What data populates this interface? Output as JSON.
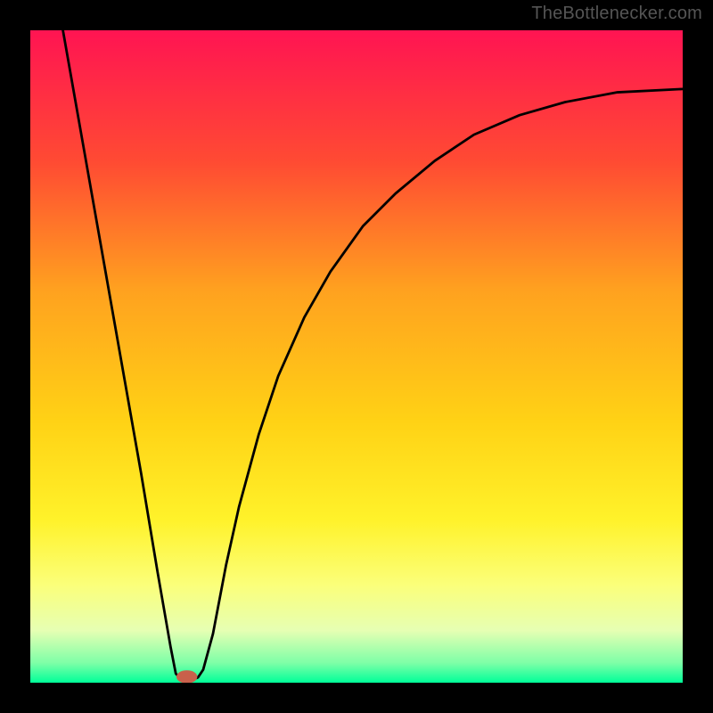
{
  "watermark": "TheBottlenecker.com",
  "chart_data": {
    "type": "line",
    "title": "",
    "xlabel": "",
    "ylabel": "",
    "xlim": [
      0,
      100
    ],
    "ylim": [
      0,
      100
    ],
    "background": {
      "gradient_stops": [
        {
          "offset": 0.0,
          "color": "#ff1452"
        },
        {
          "offset": 0.2,
          "color": "#ff4a33"
        },
        {
          "offset": 0.4,
          "color": "#ffa21f"
        },
        {
          "offset": 0.6,
          "color": "#ffd215"
        },
        {
          "offset": 0.75,
          "color": "#fff22a"
        },
        {
          "offset": 0.85,
          "color": "#fbff7a"
        },
        {
          "offset": 0.92,
          "color": "#e6ffb3"
        },
        {
          "offset": 0.97,
          "color": "#7dffa7"
        },
        {
          "offset": 1.0,
          "color": "#00ff99"
        }
      ]
    },
    "series": [
      {
        "name": "bottleneck-curve",
        "color": "#000000",
        "stroke_width": 2.8,
        "points": [
          {
            "x": 5.0,
            "y": 100.0
          },
          {
            "x": 8.0,
            "y": 83.0
          },
          {
            "x": 11.0,
            "y": 66.0
          },
          {
            "x": 14.0,
            "y": 49.0
          },
          {
            "x": 17.0,
            "y": 32.0
          },
          {
            "x": 19.5,
            "y": 17.0
          },
          {
            "x": 21.5,
            "y": 5.5
          },
          {
            "x": 22.3,
            "y": 1.4
          },
          {
            "x": 23.0,
            "y": 0.6
          },
          {
            "x": 24.0,
            "y": 0.5
          },
          {
            "x": 25.0,
            "y": 0.5
          },
          {
            "x": 25.7,
            "y": 0.8
          },
          {
            "x": 26.5,
            "y": 2.0
          },
          {
            "x": 28.0,
            "y": 7.5
          },
          {
            "x": 30.0,
            "y": 18.0
          },
          {
            "x": 32.0,
            "y": 27.0
          },
          {
            "x": 35.0,
            "y": 38.0
          },
          {
            "x": 38.0,
            "y": 47.0
          },
          {
            "x": 42.0,
            "y": 56.0
          },
          {
            "x": 46.0,
            "y": 63.0
          },
          {
            "x": 51.0,
            "y": 70.0
          },
          {
            "x": 56.0,
            "y": 75.0
          },
          {
            "x": 62.0,
            "y": 80.0
          },
          {
            "x": 68.0,
            "y": 84.0
          },
          {
            "x": 75.0,
            "y": 87.0
          },
          {
            "x": 82.0,
            "y": 89.0
          },
          {
            "x": 90.0,
            "y": 90.5
          },
          {
            "x": 100.0,
            "y": 91.0
          }
        ]
      }
    ],
    "markers": [
      {
        "name": "optimum-point",
        "shape": "ellipse",
        "cx": 24.0,
        "cy": 0.9,
        "rx": 1.6,
        "ry": 1.0,
        "fill": "#c9604b"
      }
    ]
  }
}
